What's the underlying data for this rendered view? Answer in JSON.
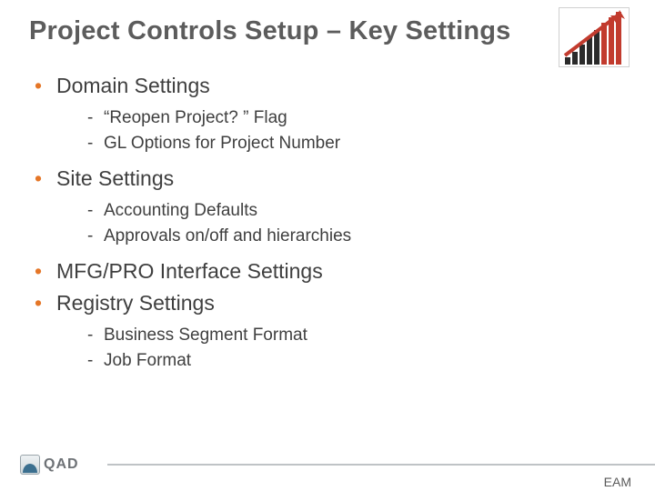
{
  "title": "Project Controls Setup – Key Settings",
  "bullets": [
    {
      "label": "Domain Settings",
      "sub": [
        "“Reopen Project? ” Flag",
        "GL Options for Project Number"
      ]
    },
    {
      "label": "Site Settings",
      "sub": [
        "Accounting Defaults",
        "Approvals on/off and hierarchies"
      ]
    },
    {
      "label": "MFG/PRO Interface Settings",
      "sub": []
    },
    {
      "label": "Registry Settings",
      "sub": [
        "Business Segment Format",
        "Job Format"
      ]
    }
  ],
  "footer": {
    "brand": "QAD",
    "corner": "EAM"
  },
  "chart_data": {
    "type": "bar",
    "categories": [
      "1",
      "2",
      "3",
      "4",
      "5",
      "6",
      "7",
      "8"
    ],
    "values": [
      8,
      14,
      22,
      30,
      38,
      46,
      54,
      62
    ],
    "overlay_arrow": true,
    "title": "",
    "xlabel": "",
    "ylabel": "",
    "ylim": [
      0,
      62
    ]
  }
}
